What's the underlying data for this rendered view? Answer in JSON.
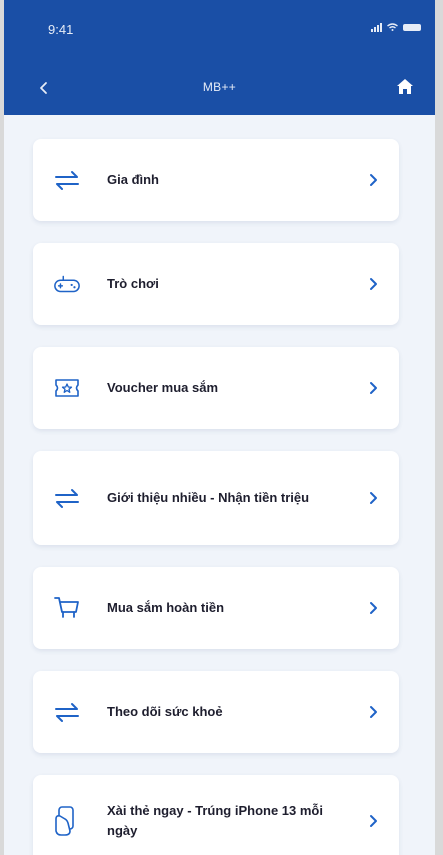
{
  "status_bar": {
    "time": "9:41"
  },
  "header": {
    "title": "MB++"
  },
  "colors": {
    "header_bg": "#1a4fa6",
    "icon_blue": "#1f63c7",
    "background": "#f0f4fa"
  },
  "menu": [
    {
      "label": "Gia đình",
      "icon": "swap-arrows-icon"
    },
    {
      "label": "Trò chơi",
      "icon": "gamepad-icon"
    },
    {
      "label": "Voucher mua sắm",
      "icon": "voucher-ticket-icon"
    },
    {
      "label": "Giới thiệu nhiều - Nhận tiền triệu",
      "icon": "swap-arrows-icon"
    },
    {
      "label": "Mua sắm hoàn tiền",
      "icon": "shopping-cart-icon"
    },
    {
      "label": "Theo dõi sức khoẻ",
      "icon": "swap-arrows-icon"
    },
    {
      "label": "Xài thẻ ngay - Trúng iPhone 13 mỗi ngày",
      "icon": "card-touch-icon"
    }
  ]
}
